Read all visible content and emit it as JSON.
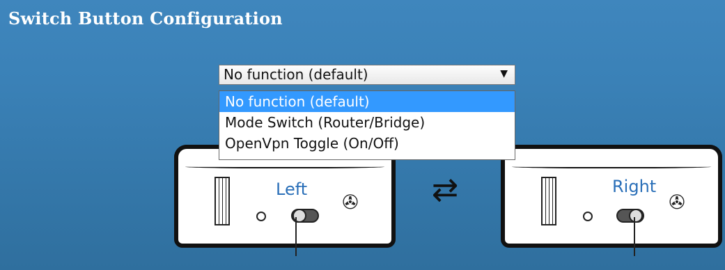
{
  "title": "Switch Button Configuration",
  "select": {
    "value": "No function (default)",
    "options": [
      "No function (default)",
      "Mode Switch (Router/Bridge)",
      "OpenVpn Toggle (On/Off)"
    ],
    "selected_index": 0
  },
  "devices": {
    "left_label": "Left",
    "right_label": "Right"
  },
  "colors": {
    "background": "#3a81b7",
    "selected_option": "#3399ff",
    "label_text": "#2a6fb8"
  },
  "icons": {
    "swap": "swap-arrows-icon",
    "fan": "fan-icon",
    "dropdown_arrow": "caret-down-icon"
  }
}
